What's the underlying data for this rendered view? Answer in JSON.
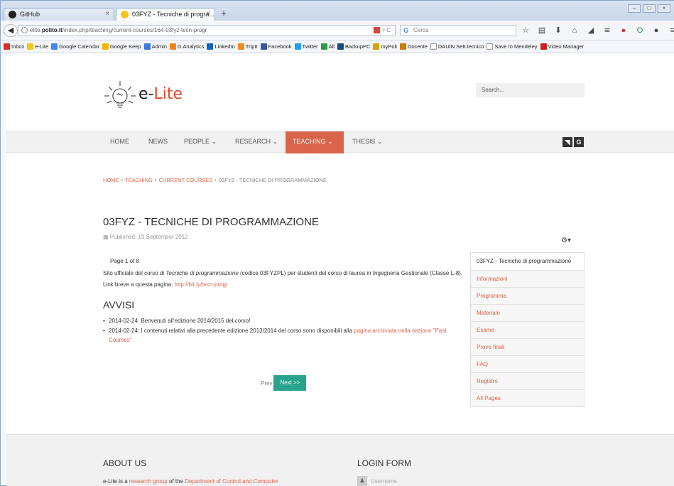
{
  "browser": {
    "tabs": [
      {
        "label": "GitHub",
        "active": false
      },
      {
        "label": "03FYZ - Tecniche di progra...",
        "active": true
      }
    ],
    "new_tab_label": "+",
    "url_prefix": "elite.",
    "url_domain": "polito.it",
    "url_path": "/index.php/teaching/current-courses/164-03fyz-tecn-progr",
    "search_placeholder": "Cerca",
    "bookmarks": [
      {
        "label": "Inbox",
        "color": "#d93025"
      },
      {
        "label": "e-Lite",
        "color": "#f5c518"
      },
      {
        "label": "Google Calendar",
        "color": "#4285f4"
      },
      {
        "label": "Google Keep",
        "color": "#f6b400"
      },
      {
        "label": "Admin",
        "color": "#3b7ddd"
      },
      {
        "label": "G Analytics",
        "color": "#f4811f"
      },
      {
        "label": "LinkedIn",
        "color": "#0a66c2"
      },
      {
        "label": "TripIt",
        "color": "#f28b20"
      },
      {
        "label": "Facebook",
        "color": "#3b5998"
      },
      {
        "label": "Twitter",
        "color": "#1da1f2"
      },
      {
        "label": "All",
        "color": "#2c9f45"
      },
      {
        "label": "BackupPC",
        "color": "#1a4a8a"
      },
      {
        "label": "myPoli",
        "color": "#d8a200"
      },
      {
        "label": "Docente",
        "color": "#cc7a00"
      },
      {
        "label": "DAUIN Sett.tecnico",
        "color": "#ffffff"
      },
      {
        "label": "Save to Mendeley",
        "color": "#ffffff"
      },
      {
        "label": "Video Manager",
        "color": "#cc1f1f"
      }
    ]
  },
  "site": {
    "logo_prefix": "e-",
    "logo_rest": "Lite",
    "search_placeholder": "Search...",
    "nav": [
      {
        "label": "HOME"
      },
      {
        "label": "NEWS"
      },
      {
        "label": "PEOPLE ⌄"
      },
      {
        "label": "RESEARCH ⌄"
      },
      {
        "label": "TEACHING ⌄",
        "active": true
      },
      {
        "label": "THESIS ⌄"
      }
    ],
    "social": [
      {
        "icon": "rss-icon",
        "glyph": "◥"
      },
      {
        "icon": "google-icon",
        "glyph": "G"
      }
    ],
    "accent_color": "#d9644a",
    "next_button_color": "#2aa38e"
  },
  "breadcrumb": {
    "items": [
      "HOME",
      "TEACHING",
      "CURRENT COURSES"
    ],
    "current": "03FYZ - TECNICHE DI PROGRAMMAZIONE"
  },
  "article": {
    "title": "03FYZ - TECNICHE DI PROGRAMMAZIONE",
    "published": "Published: 19 September 2012",
    "page_count": "Page 1 of 8",
    "intro_1": "Sito ufficiale del corso di ",
    "intro_em": "Tecniche di programmazione",
    "intro_2": " (codice 03FYZPL) per studenti del corso di laurea in Ingegneria Gestionale (Classe L-8). Link breve a questa pagina: ",
    "intro_link": "http://bit.ly/tecn-progr",
    "avvisi_title": "AVVISI",
    "avviso_1": "2014-02-24: Benvenuti all'edizione 2014/2015 del corso!",
    "avviso_2_text": "2014-02-24: I contenuti relativi alla precedente edizione 2013/2014 del corso sono disponibili alla ",
    "avviso_2_link": "pagina archiviata nella sezione \"Past Courses\"",
    "prev_label": "Prev",
    "next_label": "Next >>"
  },
  "sidemenu": {
    "items": [
      "03FYZ - Tecniche di programmazione",
      "Informazioni",
      "Programma",
      "Materiale",
      "Esame",
      "Prove finali",
      "FAQ",
      "Registro",
      "All Pages"
    ]
  },
  "footer": {
    "about_title": "ABOUT US",
    "about_text_1": "e-Lite is a ",
    "about_link_1": "research group",
    "about_text_2": " of the ",
    "about_link_2": "Department of Control and Computer",
    "login_title": "LOGIN FORM",
    "username_placeholder": "Username"
  }
}
